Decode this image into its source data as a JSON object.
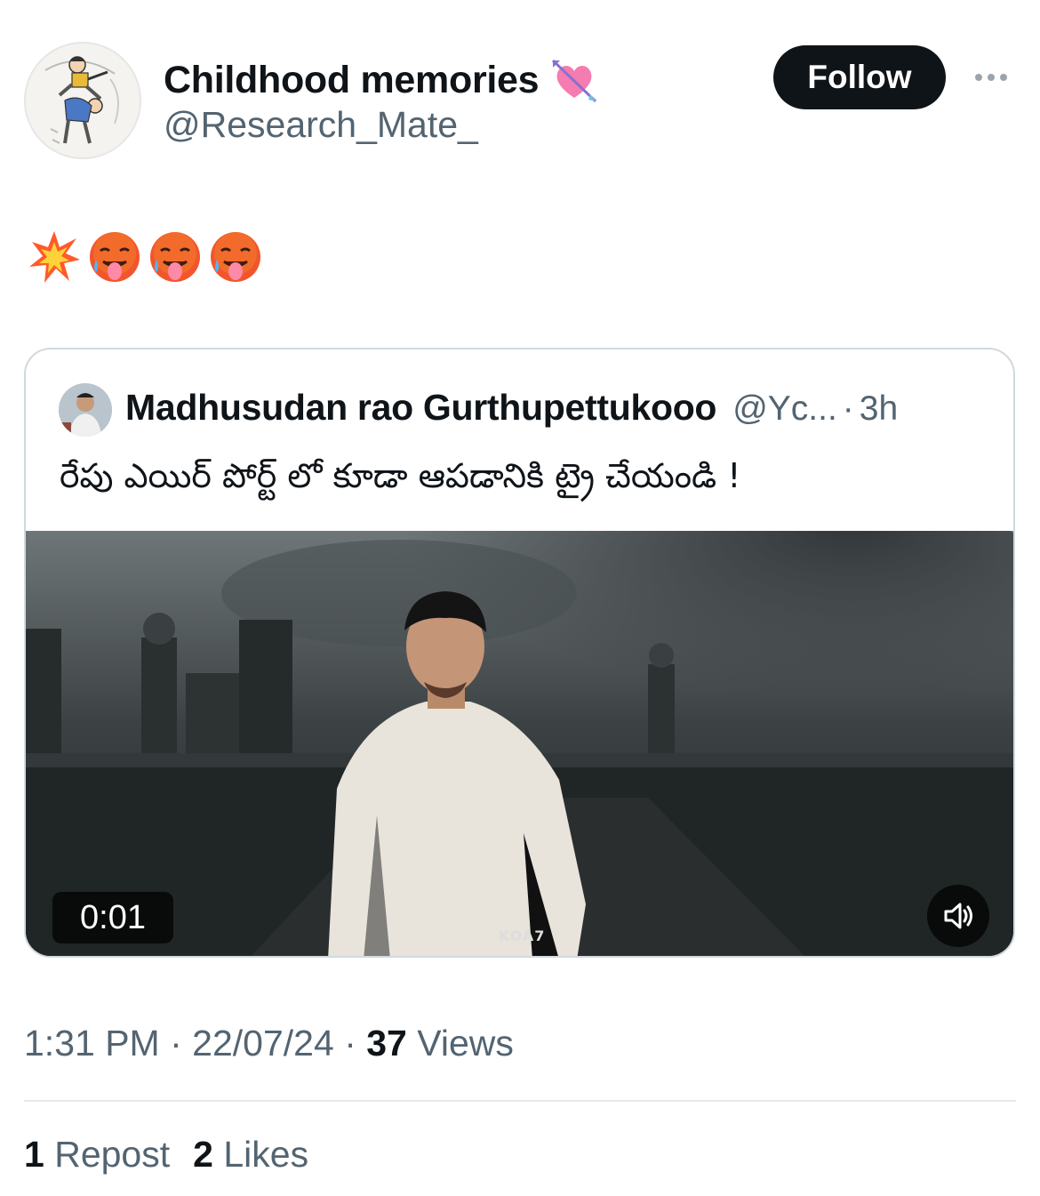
{
  "author": {
    "display_name": "Childhood memories",
    "handle": "@Research_Mate_",
    "name_emoji": "heart-with-arrow-icon"
  },
  "actions": {
    "follow_label": "Follow",
    "more_icon": "more-options-icon"
  },
  "tweet": {
    "emoji": [
      "collision-icon",
      "hot-face-icon",
      "hot-face-icon",
      "hot-face-icon"
    ]
  },
  "quote": {
    "display_name": "Madhusudan rao Gurthupettukooo",
    "handle": "@Yc...",
    "separator": "·",
    "time": "3h",
    "text": "రేపు ఎయిర్ పోర్ట్ లో కూడా ఆపడానికి ట్రై చేయండి !",
    "video": {
      "duration": "0:01",
      "watermark": "KOA7",
      "sound_icon": "speaker-icon"
    }
  },
  "meta": {
    "time": "1:31 PM",
    "separator": "·",
    "date": "22/07/24",
    "views_count": "37",
    "views_label": "Views"
  },
  "stats": {
    "reposts_count": "1",
    "reposts_label": "Repost",
    "likes_count": "2",
    "likes_label": "Likes"
  },
  "colors": {
    "text_primary": "#0f1419",
    "text_secondary": "#536471",
    "border": "#cfd9de",
    "follow_bg": "#0f1419"
  }
}
